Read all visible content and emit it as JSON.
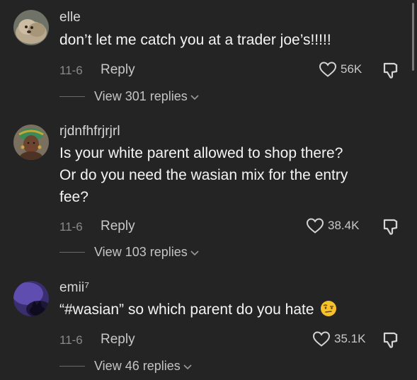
{
  "comments": [
    {
      "username": "elle",
      "text": "don’t let me catch you at a trader joe’s!!!!!",
      "date": "11-6",
      "reply_label": "Reply",
      "likes": "56K",
      "view_replies": "View 301 replies"
    },
    {
      "username": "rjdnfhfrjrjrl",
      "text_lines": [
        "Is your white parent allowed to shop there?",
        "Or do you need the wasian mix for the entry",
        "fee?"
      ],
      "date": "11-6",
      "reply_label": "Reply",
      "likes": "38.4K",
      "view_replies": "View 103 replies"
    },
    {
      "username": "emii⁷",
      "text": "“#wasian” so which parent do you hate",
      "emoji": "face-with-raised-eyebrow",
      "date": "11-6",
      "reply_label": "Reply",
      "likes": "35.1K",
      "view_replies": "View 46 replies"
    }
  ],
  "colors": {
    "background": "#242424",
    "text": "#f4f4f4",
    "muted": "#8a8a8a"
  }
}
